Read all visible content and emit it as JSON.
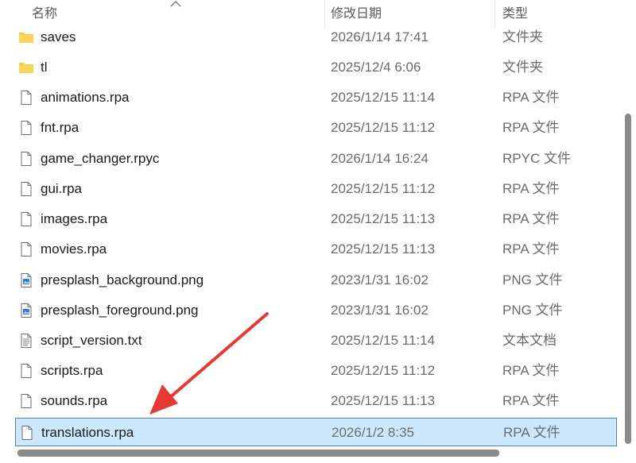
{
  "columns": {
    "name": "名称",
    "date": "修改日期",
    "type": "类型"
  },
  "files": [
    {
      "name": "saves",
      "date": "2026/1/14 17:41",
      "type": "文件夹",
      "icon": "folder-icon"
    },
    {
      "name": "tl",
      "date": "2025/12/4 6:06",
      "type": "文件夹",
      "icon": "folder-icon"
    },
    {
      "name": "animations.rpa",
      "date": "2025/12/15 11:14",
      "type": "RPA 文件",
      "icon": "file-icon"
    },
    {
      "name": "fnt.rpa",
      "date": "2025/12/15 11:12",
      "type": "RPA 文件",
      "icon": "file-icon"
    },
    {
      "name": "game_changer.rpyc",
      "date": "2026/1/14 16:24",
      "type": "RPYC 文件",
      "icon": "file-icon"
    },
    {
      "name": "gui.rpa",
      "date": "2025/12/15 11:12",
      "type": "RPA 文件",
      "icon": "file-icon"
    },
    {
      "name": "images.rpa",
      "date": "2025/12/15 11:13",
      "type": "RPA 文件",
      "icon": "file-icon"
    },
    {
      "name": "movies.rpa",
      "date": "2025/12/15 11:13",
      "type": "RPA 文件",
      "icon": "file-icon"
    },
    {
      "name": "presplash_background.png",
      "date": "2023/1/31 16:02",
      "type": "PNG 文件",
      "icon": "image-file-icon"
    },
    {
      "name": "presplash_foreground.png",
      "date": "2023/1/31 16:02",
      "type": "PNG 文件",
      "icon": "image-file-icon"
    },
    {
      "name": "script_version.txt",
      "date": "2025/12/15 11:14",
      "type": "文本文档",
      "icon": "text-file-icon"
    },
    {
      "name": "scripts.rpa",
      "date": "2025/12/15 11:12",
      "type": "RPA 文件",
      "icon": "file-icon"
    },
    {
      "name": "sounds.rpa",
      "date": "2025/12/15 11:13",
      "type": "RPA 文件",
      "icon": "file-icon"
    },
    {
      "name": "translations.rpa",
      "date": "2026/1/2 8:35",
      "type": "RPA 文件",
      "icon": "file-icon",
      "selected": true
    }
  ],
  "colors": {
    "selection": "#cce8ff",
    "selection_border": "#5a7fa8",
    "folder": "#f7c948",
    "arrow": "#e53935"
  }
}
